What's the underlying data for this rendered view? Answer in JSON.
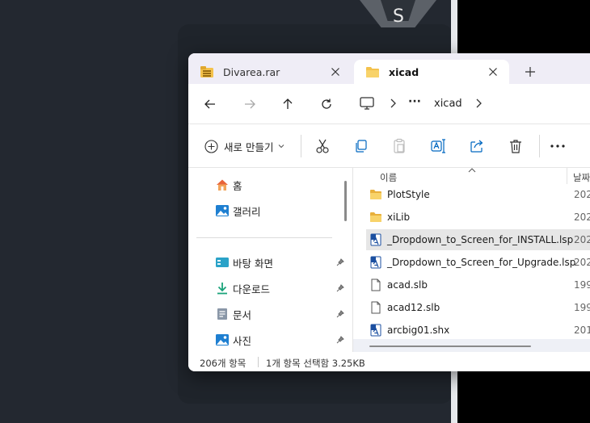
{
  "background": {
    "logo_letter": "S"
  },
  "tabs": [
    {
      "label": "Divarea.rar",
      "icon": "archive-icon",
      "active": false
    },
    {
      "label": "xicad",
      "icon": "folder-icon",
      "active": true
    }
  ],
  "navbar": {
    "crumb_more": "···",
    "crumb_folder": "xicad"
  },
  "toolbar": {
    "new_label": "새로 만들기"
  },
  "sidebar": {
    "items": [
      {
        "label": "홈",
        "icon": "home-icon",
        "pinned": false
      },
      {
        "label": "갤러리",
        "icon": "gallery-icon",
        "pinned": false
      },
      {
        "label": "바탕 화면",
        "icon": "desktop-icon",
        "pinned": true
      },
      {
        "label": "다운로드",
        "icon": "download-icon",
        "pinned": true
      },
      {
        "label": "문서",
        "icon": "document-icon",
        "pinned": true
      },
      {
        "label": "사진",
        "icon": "pictures-icon",
        "pinned": true
      }
    ]
  },
  "filelist": {
    "col_name": "이름",
    "col_date": "날짜",
    "rows": [
      {
        "name": "PlotStyle",
        "date": "202",
        "icon": "folder-icon",
        "selected": false
      },
      {
        "name": "xiLib",
        "date": "202",
        "icon": "folder-icon",
        "selected": false
      },
      {
        "name": "_Dropdown_to_Screen_for_INSTALL.lsp",
        "date": "202",
        "icon": "lsp-file-icon",
        "selected": true
      },
      {
        "name": "_Dropdown_to_Screen_for_Upgrade.lsp",
        "date": "202",
        "icon": "lsp-file-icon",
        "selected": false
      },
      {
        "name": "acad.slb",
        "date": "199",
        "icon": "blank-file-icon",
        "selected": false
      },
      {
        "name": "acad12.slb",
        "date": "199",
        "icon": "blank-file-icon",
        "selected": false
      },
      {
        "name": "arcbig01.shx",
        "date": "201",
        "icon": "shx-file-icon",
        "selected": false
      }
    ]
  },
  "status": {
    "count": "206개 항목",
    "selection": "1개 항목 선택함 3.25KB"
  },
  "colors": {
    "accent": "#0067c0",
    "folder": "#f4c24c",
    "selected_row": "#e6e6e6"
  }
}
